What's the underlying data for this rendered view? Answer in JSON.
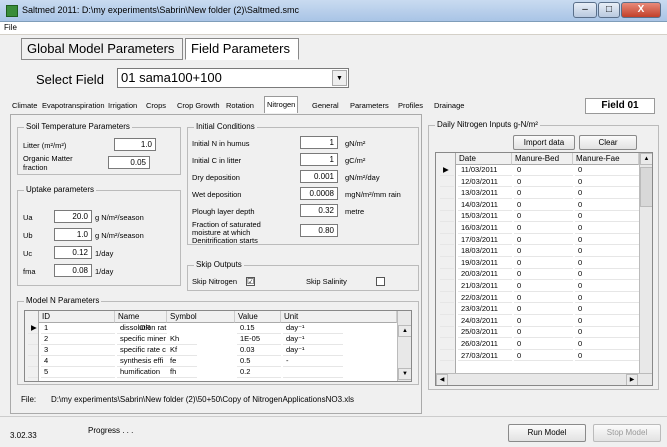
{
  "window": {
    "title": "Saltmed 2011: D:\\my experiments\\Sabrin\\New folder (2)\\Saltmed.smc",
    "minimize": "–",
    "maximize": "□",
    "close": "X"
  },
  "menu": {
    "file": "File"
  },
  "top_tabs": {
    "global": "Global Model Parameters",
    "field": "Field Parameters"
  },
  "select_field": {
    "label": "Select Field",
    "value": "01 sama100+100",
    "arrow": "▼"
  },
  "sub_tabs": [
    "Climate",
    "Evapotranspiration",
    "Irrigation",
    "Crops",
    "Crop Growth",
    "Rotation",
    "Nitrogen",
    "General",
    "Parameters",
    "Profiles",
    "Drainage"
  ],
  "field_badge": "Field 01",
  "soil_temp": {
    "title": "Soil Temperature Parameters",
    "litter_label": "Litter (m²/m²)",
    "litter_value": "1.0",
    "om_label_1": "Organic Matter",
    "om_label_2": "fraction",
    "om_value": "0.05"
  },
  "uptake": {
    "title": "Uptake parameters",
    "rows": [
      {
        "label": "Ua",
        "value": "20.0",
        "unit": "g N/m²/season"
      },
      {
        "label": "Ub",
        "value": "1.0",
        "unit": "g N/m²/season"
      },
      {
        "label": "Uc",
        "value": "0.12",
        "unit": "1/day"
      },
      {
        "label": "fma",
        "value": "0.08",
        "unit": "1/day"
      }
    ]
  },
  "initial": {
    "title": "Initial Conditions",
    "rows": [
      {
        "label": "Initial N in humus",
        "value": "1",
        "unit": "gN/m²"
      },
      {
        "label": "Initial C in litter",
        "value": "1",
        "unit": "gC/m²"
      },
      {
        "label": "Dry deposition",
        "value": "0.001",
        "unit": "gN/m²/day"
      },
      {
        "label": "Wet deposition",
        "value": "0.0008",
        "unit": "mgN/m²/mm rain"
      },
      {
        "label": "Plough layer depth",
        "value": "0.32",
        "unit": "metre"
      }
    ],
    "fraction_label_1": "Fraction of saturated",
    "fraction_label_2": "moisture at which",
    "fraction_label_3": "Denitrification starts",
    "fraction_value": "0.80"
  },
  "skip": {
    "title": "Skip Outputs",
    "nitrogen_label": "Skip Nitrogen",
    "nitrogen_checked": "☑",
    "salinity_label": "Skip Salinity"
  },
  "model_n": {
    "title": "Model N Parameters",
    "columns": [
      "ID",
      "Name",
      "Symbol",
      "Value",
      "Unit"
    ],
    "rows": [
      {
        "marker": "▶",
        "id": "1",
        "name": "dissolution rat",
        "symbol": "DR",
        "value": "0.15",
        "unit": "day⁻¹"
      },
      {
        "marker": "",
        "id": "2",
        "name": "specific miner",
        "symbol": "Kh",
        "value": "1E-05",
        "unit": "day⁻¹"
      },
      {
        "marker": "",
        "id": "3",
        "name": "specific rate c",
        "symbol": "Kf",
        "value": "0.03",
        "unit": "day⁻¹"
      },
      {
        "marker": "",
        "id": "4",
        "name": "synthesis effi",
        "symbol": "fe",
        "value": "0.5",
        "unit": "-"
      },
      {
        "marker": "",
        "id": "5",
        "name": "humification",
        "symbol": "fh",
        "value": "0.2",
        "unit": ""
      }
    ]
  },
  "daily_n": {
    "title": "Daily Nitrogen Inputs g-N/m²",
    "import_label": "Import data",
    "clear_label": "Clear",
    "columns": [
      "Date",
      "Manure-Bed",
      "Manure-Fae"
    ],
    "rows": [
      {
        "marker": "▶",
        "date": "11/03/2011",
        "bed": "0",
        "fae": "0"
      },
      {
        "marker": "",
        "date": "12/03/2011",
        "bed": "0",
        "fae": "0"
      },
      {
        "marker": "",
        "date": "13/03/2011",
        "bed": "0",
        "fae": "0"
      },
      {
        "marker": "",
        "date": "14/03/2011",
        "bed": "0",
        "fae": "0"
      },
      {
        "marker": "",
        "date": "15/03/2011",
        "bed": "0",
        "fae": "0"
      },
      {
        "marker": "",
        "date": "16/03/2011",
        "bed": "0",
        "fae": "0"
      },
      {
        "marker": "",
        "date": "17/03/2011",
        "bed": "0",
        "fae": "0"
      },
      {
        "marker": "",
        "date": "18/03/2011",
        "bed": "0",
        "fae": "0"
      },
      {
        "marker": "",
        "date": "19/03/2011",
        "bed": "0",
        "fae": "0"
      },
      {
        "marker": "",
        "date": "20/03/2011",
        "bed": "0",
        "fae": "0"
      },
      {
        "marker": "",
        "date": "21/03/2011",
        "bed": "0",
        "fae": "0"
      },
      {
        "marker": "",
        "date": "22/03/2011",
        "bed": "0",
        "fae": "0"
      },
      {
        "marker": "",
        "date": "23/03/2011",
        "bed": "0",
        "fae": "0"
      },
      {
        "marker": "",
        "date": "24/03/2011",
        "bed": "0",
        "fae": "0"
      },
      {
        "marker": "",
        "date": "25/03/2011",
        "bed": "0",
        "fae": "0"
      },
      {
        "marker": "",
        "date": "26/03/2011",
        "bed": "0",
        "fae": "0"
      },
      {
        "marker": "",
        "date": "27/03/2011",
        "bed": "0",
        "fae": "0"
      }
    ]
  },
  "file_path": {
    "label": "File:",
    "value": "D:\\my experiments\\Sabrin\\New folder (2)\\50+50\\Copy of NitrogenApplicationsNO3.xls"
  },
  "status": {
    "version": "3.02.33",
    "progress": "Progress . . .",
    "run_label": "Run Model",
    "stop_label": "Stop Model"
  },
  "arrows": {
    "up": "▲",
    "down": "▼",
    "left": "◀",
    "right": "▶"
  }
}
